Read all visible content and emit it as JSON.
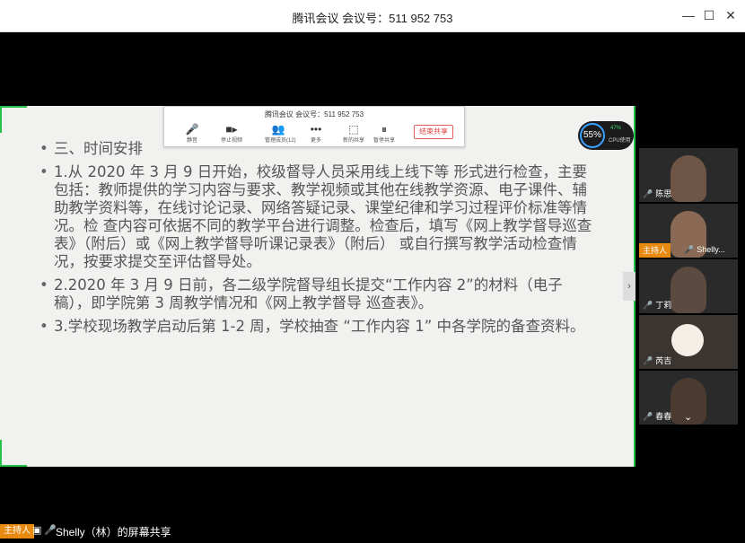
{
  "window": {
    "title": "腾讯会议 会议号：511 952 753",
    "minimize": "—",
    "maximize": "☐",
    "close": "✕"
  },
  "toolbar": {
    "title": "腾讯会议 会议号：511 952 753",
    "items": [
      {
        "label": "静音",
        "icon": "mic-icon",
        "glyph": "🎤"
      },
      {
        "label": "停止视频",
        "icon": "camera-icon",
        "glyph": "■▸"
      },
      {
        "label": "管理成员(12)",
        "icon": "members-icon",
        "glyph": "👥"
      },
      {
        "label": "更多",
        "icon": "more-icon",
        "glyph": "•••"
      },
      {
        "label": "新的共享",
        "icon": "new-share-icon",
        "glyph": "⬚"
      },
      {
        "label": "暂停共享",
        "icon": "pause-share-icon",
        "glyph": "⏸"
      }
    ],
    "end_share": "结束共享"
  },
  "cpu": {
    "value": "55%",
    "pct": "47%",
    "label": "CPU使用"
  },
  "slide": {
    "bullets": [
      "三、时间安排",
      "1.从 2020 年 3 月 9 日开始，校级督导人员采用线上线下等 形式进行检查，主要包括：教师提供的学习内容与要求、教学视频或其他在线教学资源、电子课件、辅助教学资料等，在线讨论记录、网络答疑记录、课堂纪律和学习过程评价标准等情况。检 查内容可依据不同的教学平台进行调整。检查后，填写《网上教学督导巡查表》（附后）或《网上教学督导听课记录表》（附后） 或自行撰写教学活动检查情况，按要求提交至评估督导处。",
      "2.2020 年 3 月 9 日前，各二级学院督导组长提交“工作内容 2”的材料（电子稿），即学院第 3 周教学情况和《网上教学督导 巡查表》。",
      "3.学校现场教学启动后第 1-2 周，学校抽查 “工作内容 1” 中各学院的备查资料。"
    ]
  },
  "participants": [
    {
      "name": "陈思",
      "host": false
    },
    {
      "name": "Shelly...",
      "host": true,
      "host_label": "主持人"
    },
    {
      "name": "丁莉",
      "host": false
    },
    {
      "name": "芮吉",
      "host": false
    },
    {
      "name": "春春",
      "host": false
    }
  ],
  "colors": {
    "accent_green": "#27c24c",
    "host_orange": "#e88a10",
    "mic_red": "#e84a4a"
  },
  "bottom": {
    "host_label": "主持人",
    "text": "Shelly（林）的屏幕共享"
  }
}
